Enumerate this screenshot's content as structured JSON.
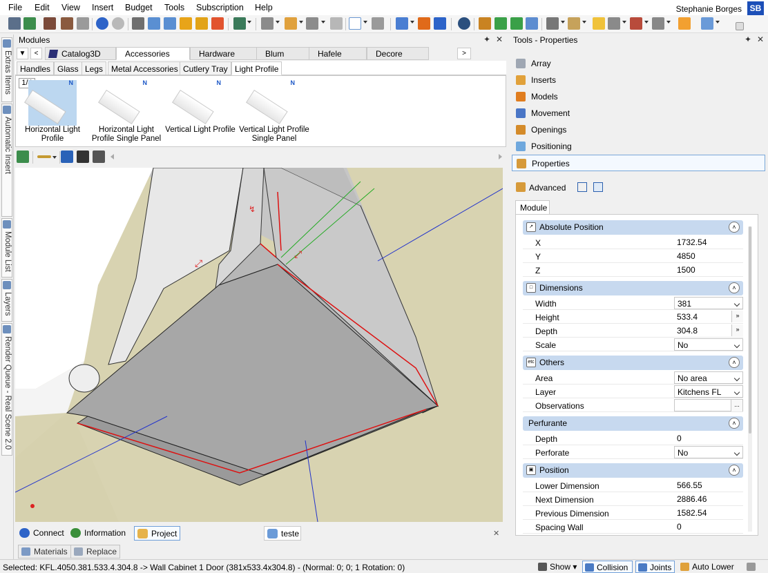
{
  "menu": [
    "File",
    "Edit",
    "View",
    "Insert",
    "Budget",
    "Tools",
    "Subscription",
    "Help"
  ],
  "user": {
    "name": "Stephanie Borges",
    "initials": "SB"
  },
  "left_dock": [
    "Extras Items",
    "Automatic Insert",
    "Module List",
    "Layers",
    "Render Queue - Real Scene 2.0"
  ],
  "modules": {
    "title": "Modules",
    "pin": "✦",
    "close": "✕",
    "category_tabs": [
      "Catalog3D",
      "Accessories",
      "Hardware",
      "Blum",
      "Hafele",
      "Decore"
    ],
    "active_category": "Accessories",
    "subtabs": [
      "Handles",
      "Glass",
      "Legs",
      "Metal Accessories",
      "Cutlery Tray",
      "Light Profile"
    ],
    "active_subtab": "Light Profile",
    "page_indicator": "1/4",
    "items": [
      {
        "label": "Horizontal Light Profile",
        "badge": "N",
        "selected": true
      },
      {
        "label": "Horizontal Light Profile Single Panel",
        "badge": "N",
        "selected": false
      },
      {
        "label": "Vertical Light Profile",
        "badge": "N",
        "selected": false
      },
      {
        "label": "Vertical Light Profile Single Panel",
        "badge": "N",
        "selected": false
      }
    ]
  },
  "bottom_tabs": {
    "connect": "Connect",
    "information": "Information",
    "project": "Project",
    "teste": "teste",
    "close": "✕"
  },
  "material_tabs": {
    "materials": "Materials",
    "replace": "Replace"
  },
  "tools_panel": {
    "title": "Tools - Properties",
    "pin": "✦",
    "close": "✕",
    "tools": [
      "Array",
      "Inserts",
      "Models",
      "Movement",
      "Openings",
      "Positioning",
      "Properties"
    ],
    "active_tool": "Properties",
    "advanced_label": "Advanced",
    "module_tab": "Module"
  },
  "properties": {
    "absolute_position": {
      "title": "Absolute Position",
      "rows": [
        {
          "label": "X",
          "value": "1732.54"
        },
        {
          "label": "Y",
          "value": "4850"
        },
        {
          "label": "Z",
          "value": "1500"
        }
      ]
    },
    "dimensions": {
      "title": "Dimensions",
      "rows": [
        {
          "label": "Width",
          "value": "381"
        },
        {
          "label": "Height",
          "value": "533.4"
        },
        {
          "label": "Depth",
          "value": "304.8"
        },
        {
          "label": "Scale",
          "value": "No"
        }
      ]
    },
    "others": {
      "title": "Others",
      "rows": [
        {
          "label": "Area",
          "value": "No area"
        },
        {
          "label": "Layer",
          "value": "Kitchens FL"
        },
        {
          "label": "Observations",
          "value": ""
        }
      ]
    },
    "perfurante": {
      "title": "Perfurante",
      "rows": [
        {
          "label": "Depth",
          "value": "0"
        },
        {
          "label": "Perforate",
          "value": "No"
        }
      ]
    },
    "position": {
      "title": "Position",
      "rows": [
        {
          "label": "Lower Dimension",
          "value": "566.55"
        },
        {
          "label": "Next Dimension",
          "value": "2886.46"
        },
        {
          "label": "Previous Dimension",
          "value": "1582.54"
        },
        {
          "label": "Spacing Wall",
          "value": "0"
        }
      ]
    }
  },
  "status": {
    "text": "Selected: KFL.4050.381.533.4.304.8 -> Wall Cabinet 1 Door (381x533.4x304.8) - (Normal: 0; 0; 1 Rotation: 0)",
    "show": "Show",
    "collision": "Collision",
    "joints": "Joints",
    "auto_lower": "Auto Lower"
  },
  "colors": {
    "accent": "#1c4fb8",
    "group_header": "#c7d9ef",
    "viewport_bg": "#d8d3b1"
  }
}
